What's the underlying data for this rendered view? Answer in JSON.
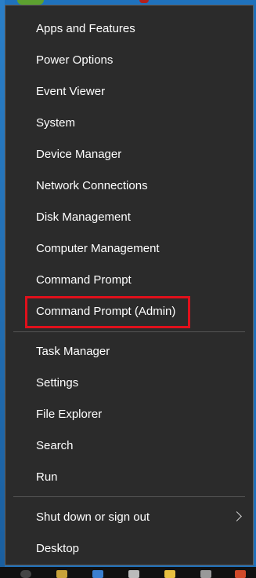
{
  "menu": {
    "group1": [
      {
        "label": "Apps and Features"
      },
      {
        "label": "Power Options"
      },
      {
        "label": "Event Viewer"
      },
      {
        "label": "System"
      },
      {
        "label": "Device Manager"
      },
      {
        "label": "Network Connections"
      },
      {
        "label": "Disk Management"
      },
      {
        "label": "Computer Management"
      },
      {
        "label": "Command Prompt"
      },
      {
        "label": "Command Prompt (Admin)"
      }
    ],
    "group2": [
      {
        "label": "Task Manager"
      },
      {
        "label": "Settings"
      },
      {
        "label": "File Explorer"
      },
      {
        "label": "Search"
      },
      {
        "label": "Run"
      }
    ],
    "group3": [
      {
        "label": "Shut down or sign out"
      },
      {
        "label": "Desktop"
      }
    ]
  },
  "colors": {
    "menu_bg": "#2b2b2b",
    "text": "#ffffff",
    "highlight_border": "#e0101b",
    "separator": "#555555"
  }
}
